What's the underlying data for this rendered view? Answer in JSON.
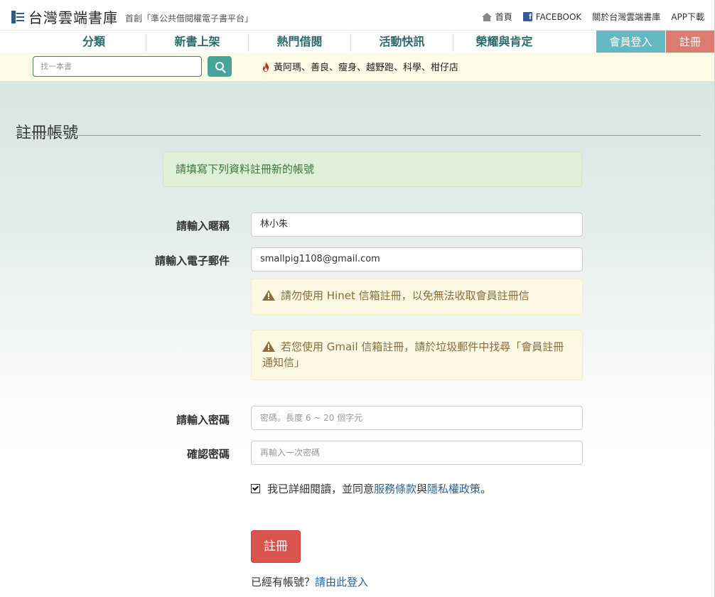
{
  "header": {
    "site_name": "台灣雲端書庫",
    "slogan": "首創「準公共借閱權電子書平台」",
    "links": {
      "home": "首頁",
      "facebook": "FACEBOOK",
      "about": "關於台灣雲端書庫",
      "app": "APP下載"
    }
  },
  "nav": {
    "items": [
      "分類",
      "新書上架",
      "熱門借閱",
      "活動快訊",
      "榮耀與肯定"
    ],
    "login": "會員登入",
    "register": "註冊"
  },
  "search": {
    "placeholder": "找一本書",
    "hot_keywords": "黃阿瑪、善良、瘦身、越野跑、科學、柑仔店"
  },
  "page": {
    "title": "註冊帳號",
    "info": "請填寫下列資料註冊新的帳號"
  },
  "form": {
    "nickname_label": "請輸入暱稱",
    "nickname_value": "林小朱",
    "email_label": "請輸入電子郵件",
    "email_value": "smallpig1108@gmail.com",
    "warning_hinet": "請勿使用 Hinet 信箱註冊，以免無法收取會員註冊信",
    "warning_gmail": "若您使用 Gmail 信箱註冊，請於垃圾郵件中找尋「會員註冊通知信」",
    "password_label": "請輸入密碼",
    "password_placeholder": "密碼。長度 6 ~ 20 個字元",
    "confirm_label": "確認密碼",
    "confirm_placeholder": "再輸入一次密碼",
    "agree_prefix": "我已詳細閱讀，並同意",
    "terms_link": "服務條款",
    "agree_and": "與",
    "privacy_link": "隱私權政策",
    "agree_suffix": "。",
    "agree_checked": true,
    "submit": "註冊",
    "already_text": "已經有帳號？",
    "login_link": "請由此登入"
  },
  "colors": {
    "nav_text": "#2d6b68",
    "login_bg": "#63b8c4",
    "register_bg": "#dc7b6f",
    "search_btn": "#47a49a",
    "submit_bg": "#d9534f",
    "link": "#2a6496"
  }
}
